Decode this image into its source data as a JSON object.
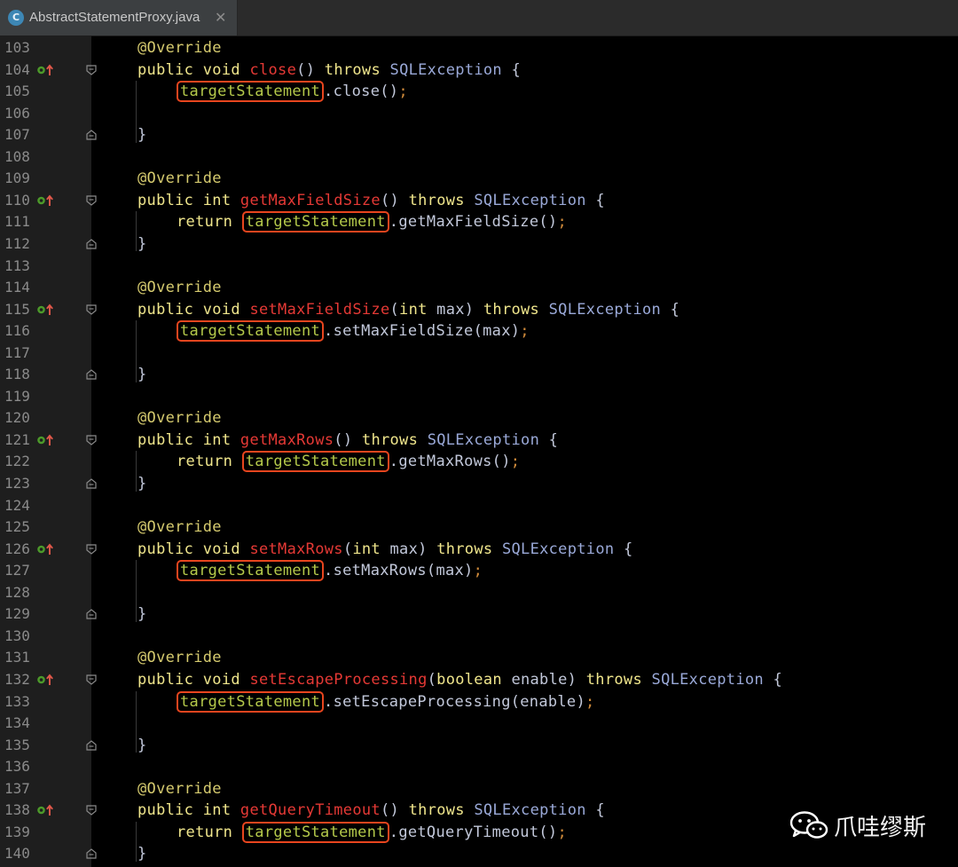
{
  "tab": {
    "file_name": "AbstractStatementProxy.java",
    "file_icon_letter": "C",
    "close_glyph": "✕"
  },
  "code": {
    "override": "@Override",
    "public": "public",
    "void": "void",
    "int": "int",
    "throws": "throws",
    "return": "return",
    "exception": "SQLException",
    "open_brace": "{",
    "close_brace": "}",
    "target": "targetStatement",
    "methods": [
      {
        "name": "close",
        "params_open": "(",
        "param_type": "",
        "param_name": "",
        "params_close": ")",
        "call": ".close()",
        "semi": ";"
      },
      {
        "name": "getMaxFieldSize",
        "params_open": "(",
        "param_type": "",
        "param_name": "",
        "params_close": ")",
        "call": ".getMaxFieldSize()",
        "semi": ";"
      },
      {
        "name": "setMaxFieldSize",
        "params_open": "(",
        "param_type": "int",
        "param_name": " max",
        "params_close": ")",
        "call": ".setMaxFieldSize(max)",
        "semi": ";"
      },
      {
        "name": "getMaxRows",
        "params_open": "(",
        "param_type": "",
        "param_name": "",
        "params_close": ")",
        "call": ".getMaxRows()",
        "semi": ";"
      },
      {
        "name": "setMaxRows",
        "params_open": "(",
        "param_type": "int",
        "param_name": " max",
        "params_close": ")",
        "call": ".setMaxRows(max)",
        "semi": ";"
      },
      {
        "name": "setEscapeProcessing",
        "params_open": "(",
        "param_type": "boolean",
        "param_name": " enable",
        "params_close": ")",
        "call": ".setEscapeProcessing(enable)",
        "semi": ";"
      },
      {
        "name": "getQueryTimeout",
        "params_open": "(",
        "param_type": "",
        "param_name": "",
        "params_close": ")",
        "call": ".getQueryTimeout()",
        "semi": ";"
      }
    ]
  },
  "line_numbers": [
    "103",
    "104",
    "105",
    "106",
    "107",
    "108",
    "109",
    "110",
    "111",
    "112",
    "113",
    "114",
    "115",
    "116",
    "117",
    "118",
    "119",
    "120",
    "121",
    "122",
    "123",
    "124",
    "125",
    "126",
    "127",
    "128",
    "129",
    "130",
    "131",
    "132",
    "133",
    "134",
    "135",
    "136",
    "137",
    "138",
    "139",
    "140"
  ],
  "icons": {
    "override_marker": "override-implements-icon",
    "fold": "fold-marker-icon"
  },
  "colors": {
    "highlight_box": "#e8451e",
    "method_name": "#e53935",
    "keyword": "#f0e68c",
    "field": "#b5c94a"
  },
  "watermark": {
    "text": "爪哇缪斯"
  }
}
